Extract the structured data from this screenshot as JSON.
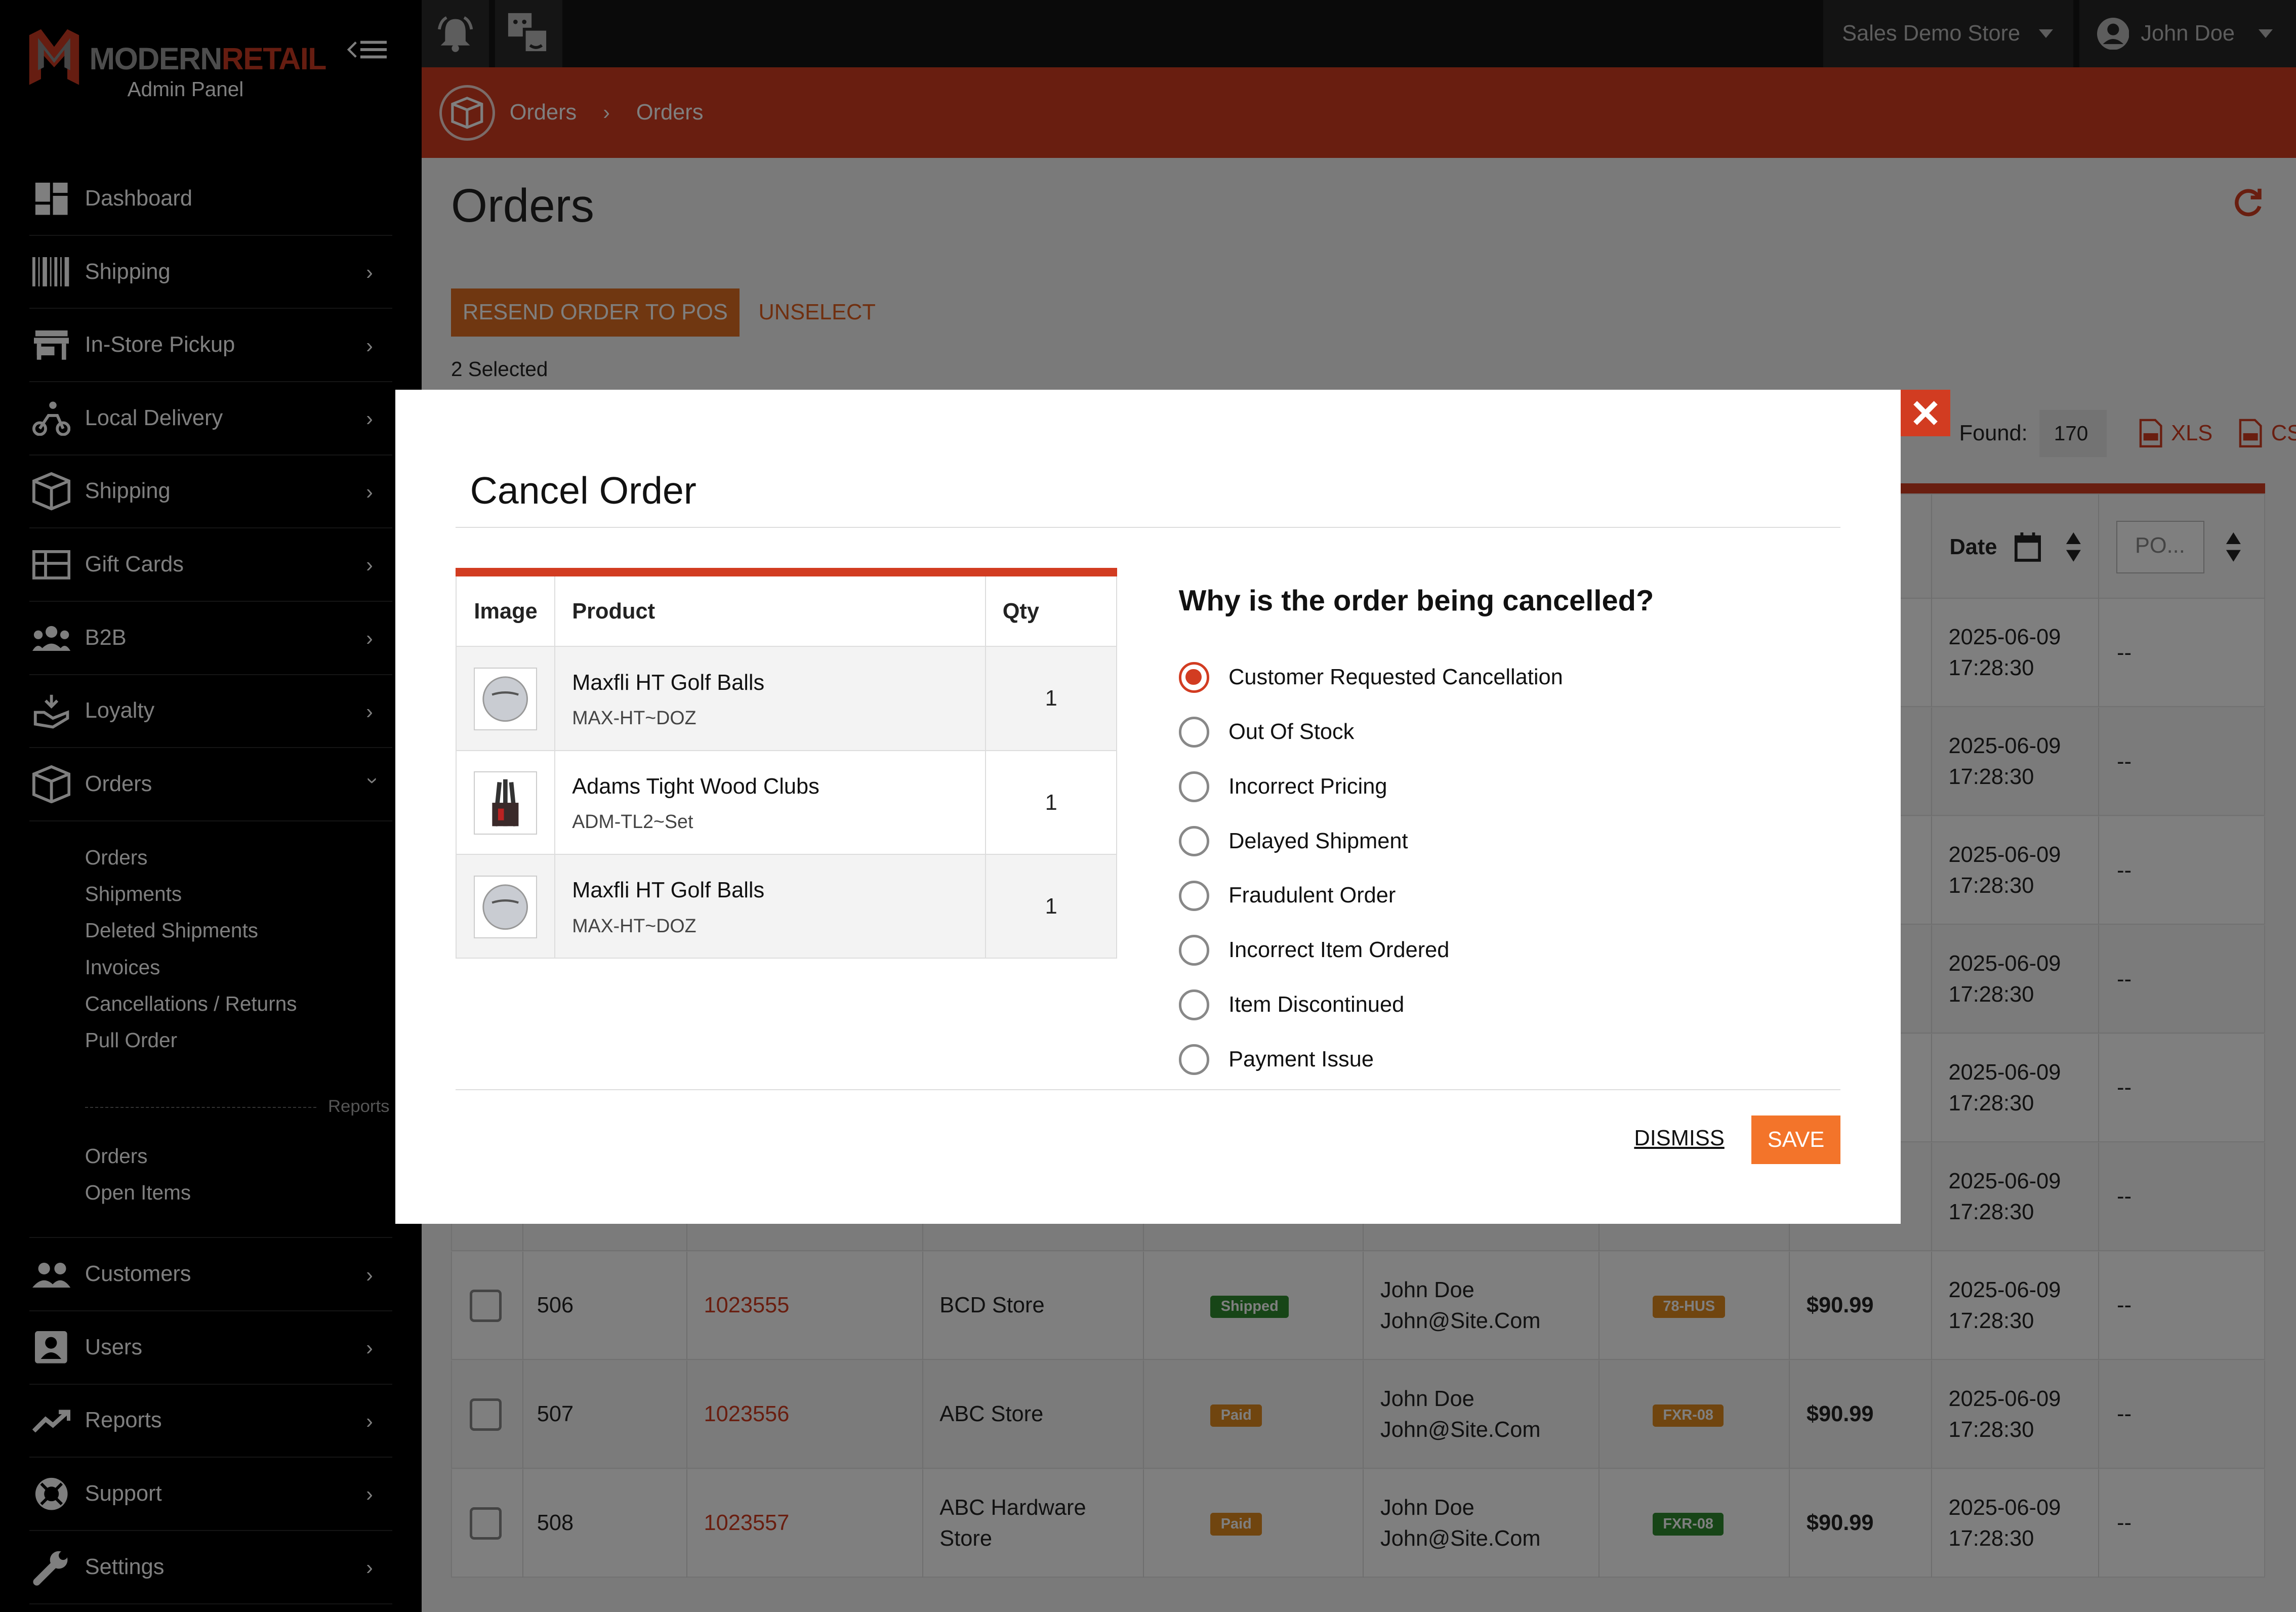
{
  "app": {
    "brand_a": "MODERN",
    "brand_b": "RETAIL",
    "subtitle": "Admin Panel"
  },
  "topbar": {
    "store": "Sales Demo Store",
    "user": "John Doe"
  },
  "breadcrumb": [
    "Orders",
    "Orders"
  ],
  "sidebar": {
    "items": [
      {
        "label": "Dashboard",
        "icon": "dashboard-icon"
      },
      {
        "label": "Shipping",
        "icon": "barcode-icon"
      },
      {
        "label": "In-Store Pickup",
        "icon": "store-icon"
      },
      {
        "label": "Local Delivery",
        "icon": "delivery-icon"
      },
      {
        "label": "Shipping",
        "icon": "box-icon"
      },
      {
        "label": "Gift Cards",
        "icon": "giftcard-icon"
      },
      {
        "label": "B2B",
        "icon": "group-icon"
      },
      {
        "label": "Loyalty",
        "icon": "loyalty-icon"
      },
      {
        "label": "Orders",
        "icon": "box-icon"
      }
    ],
    "orders_sub": [
      "Orders",
      "Shipments",
      "Deleted Shipments",
      "Invoices",
      "Cancellations / Returns",
      "Pull Order"
    ],
    "reports_label": "Reports",
    "reports_sub": [
      "Orders",
      "Open Items"
    ],
    "lower_items": [
      {
        "label": "Customers",
        "icon": "customers-icon"
      },
      {
        "label": "Users",
        "icon": "user-card-icon"
      },
      {
        "label": "Reports",
        "icon": "trending-icon"
      },
      {
        "label": "Support",
        "icon": "lifebuoy-icon"
      },
      {
        "label": "Settings",
        "icon": "wrench-icon"
      }
    ]
  },
  "page": {
    "title": "Orders",
    "resend_label": "RESEND ORDER TO POS",
    "unselect_label": "UNSELECT",
    "selected_text": "2 Selected",
    "found_label": "Found:",
    "found_value": "170",
    "xls_label": "XLS",
    "csv_label": "CSV"
  },
  "table": {
    "date_header": "Date",
    "po_placeholder": "PO...",
    "rows": [
      {
        "id": "",
        "num": "",
        "store": "",
        "status": "",
        "status_color": "",
        "customer": "",
        "email": "",
        "tag": "",
        "tag_color": "",
        "price": "",
        "date": "2025-06-09",
        "time": "17:28:30",
        "po": "--"
      },
      {
        "id": "",
        "num": "",
        "store": "",
        "status": "",
        "status_color": "",
        "customer": "",
        "email": "",
        "tag": "",
        "tag_color": "",
        "price": "",
        "date": "2025-06-09",
        "time": "17:28:30",
        "po": "--"
      },
      {
        "id": "",
        "num": "",
        "store": "",
        "status": "",
        "status_color": "",
        "customer": "",
        "email": "",
        "tag": "",
        "tag_color": "",
        "price": "",
        "date": "2025-06-09",
        "time": "17:28:30",
        "po": "--"
      },
      {
        "id": "",
        "num": "",
        "store": "",
        "status": "",
        "status_color": "",
        "customer": "",
        "email": "",
        "tag": "",
        "tag_color": "",
        "price": "",
        "date": "2025-06-09",
        "time": "17:28:30",
        "po": "--"
      },
      {
        "id": "",
        "num": "",
        "store": "",
        "status": "",
        "status_color": "",
        "customer": "",
        "email": "",
        "tag": "",
        "tag_color": "",
        "price": "",
        "date": "2025-06-09",
        "time": "17:28:30",
        "po": "--"
      },
      {
        "id": "",
        "num": "",
        "store": "",
        "status": "",
        "status_color": "",
        "customer": "",
        "email": "",
        "tag": "",
        "tag_color": "",
        "price": "",
        "date": "2025-06-09",
        "time": "17:28:30",
        "po": "--"
      },
      {
        "id": "506",
        "num": "1023555",
        "store": "BCD Store",
        "status": "Shipped",
        "status_color": "#2e8b2e",
        "customer": "John Doe",
        "email": "John@Site.Com",
        "tag": "78-HUS",
        "tag_color": "#e08a1e",
        "price": "$90.99",
        "date": "2025-06-09",
        "time": "17:28:30",
        "po": "--"
      },
      {
        "id": "507",
        "num": "1023556",
        "store": "ABC Store",
        "status": "Paid",
        "status_color": "#e08a1e",
        "customer": "John Doe",
        "email": "John@Site.Com",
        "tag": "FXR-08",
        "tag_color": "#e08a1e",
        "price": "$90.99",
        "date": "2025-06-09",
        "time": "17:28:30",
        "po": "--"
      },
      {
        "id": "508",
        "num": "1023557",
        "store": "ABC Hardware Store",
        "status": "Paid",
        "status_color": "#e08a1e",
        "customer": "John Doe",
        "email": "John@Site.Com",
        "tag": "FXR-08",
        "tag_color": "#2e8b2e",
        "price": "$90.99",
        "date": "2025-06-09",
        "time": "17:28:30",
        "po": "--"
      }
    ]
  },
  "modal": {
    "title": "Cancel Order",
    "columns": [
      "Image",
      "Product",
      "Qty"
    ],
    "products": [
      {
        "name": "Maxfli HT Golf Balls",
        "sku": "MAX-HT~DOZ",
        "qty": "1",
        "icon": "golf-ball-icon"
      },
      {
        "name": "Adams Tight Wood Clubs",
        "sku": "ADM-TL2~Set",
        "qty": "1",
        "icon": "golf-clubs-icon"
      },
      {
        "name": "Maxfli HT Golf Balls",
        "sku": "MAX-HT~DOZ",
        "qty": "1",
        "icon": "golf-ball-icon"
      }
    ],
    "question": "Why is the order being cancelled?",
    "reasons": [
      "Customer Requested Cancellation",
      "Out Of Stock",
      "Incorrect Pricing",
      "Delayed Shipment",
      "Fraudulent Order",
      "Incorrect Item Ordered",
      "Item Discontinued",
      "Payment Issue"
    ],
    "selected_reason": "Customer Requested Cancellation",
    "dismiss_label": "DISMISS",
    "save_label": "SAVE"
  },
  "colors": {
    "accent": "#d23c21",
    "orange": "#f3742a",
    "sidebar": "#000000"
  }
}
